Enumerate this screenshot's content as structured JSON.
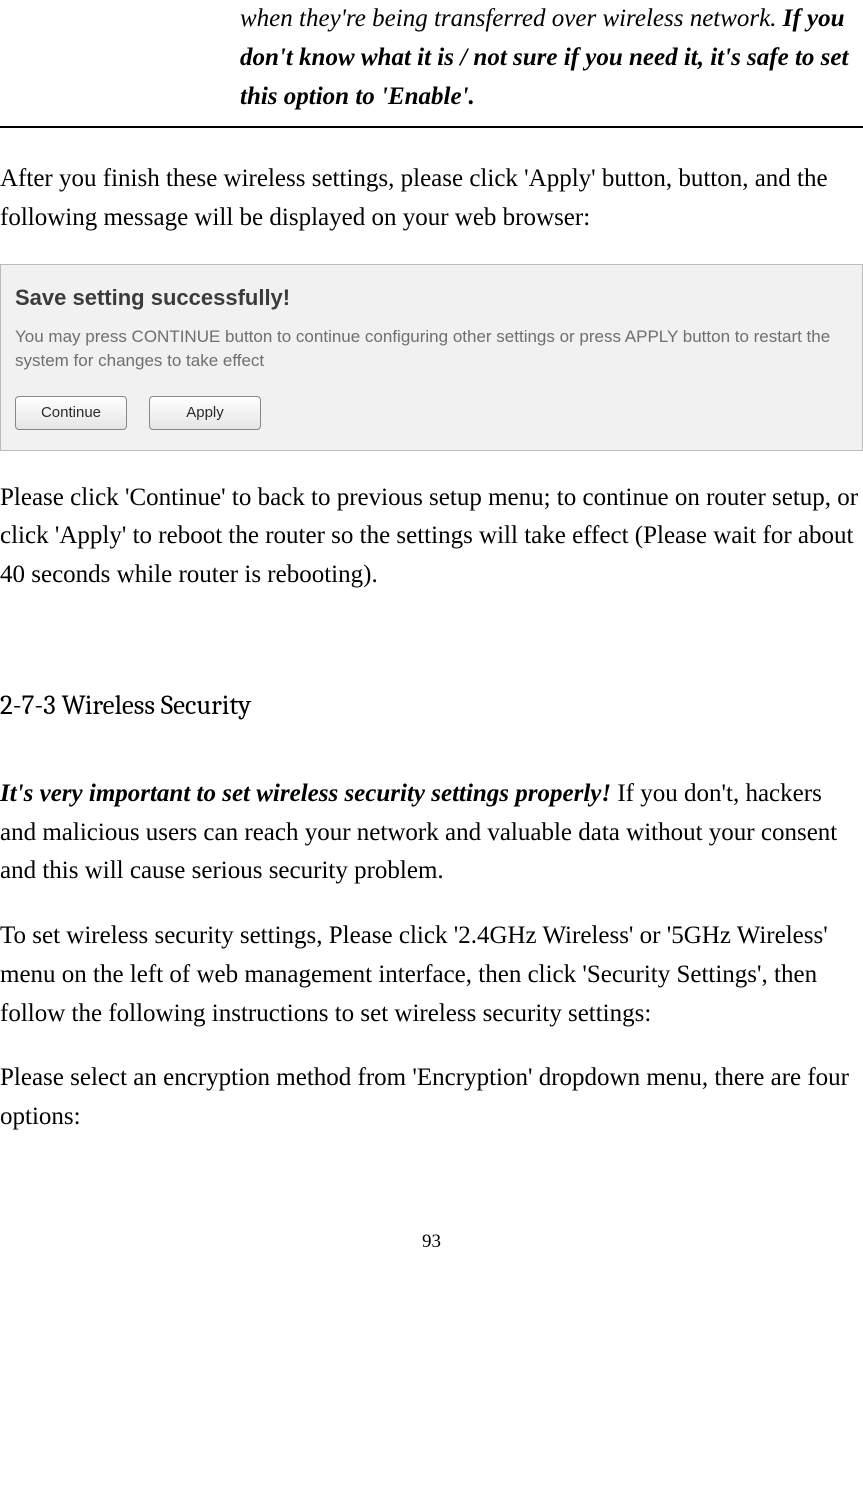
{
  "top_cell": {
    "line1": "when they're being transferred over wireless network. ",
    "bold": "If you don't know what it is / not sure if you need it, it's safe to set this option to 'Enable'."
  },
  "para_after_apply": "After you finish these wireless settings, please click 'Apply' button, button, and the following message will be displayed on your web browser:",
  "dialog": {
    "title": "Save setting successfully!",
    "message": "You may press CONTINUE button to continue configuring other settings or press APPLY button to restart the system for changes to take effect",
    "continue_label": "Continue",
    "apply_label": "Apply"
  },
  "para_continue": "Please click 'Continue' to back to previous setup menu; to continue on router setup, or click 'Apply' to reboot the router so the settings will take effect (Please wait for about 40 seconds while router is rebooting).",
  "section_heading": "2-7-3 Wireless Security",
  "security_para": {
    "bold_lead": "It's very important to set wireless security settings properly!",
    "rest": " If you don't, hackers and malicious users can reach your network and valuable data without your consent and this will cause serious security problem."
  },
  "para_instructions": "To set wireless security settings, Please click '2.4GHz Wireless' or '5GHz Wireless' menu on the left of web management interface, then click 'Security Settings', then follow the following instructions to set wireless security settings:",
  "para_encryption": "Please select an encryption method from 'Encryption' dropdown menu, there are four options:",
  "page_number": "93"
}
